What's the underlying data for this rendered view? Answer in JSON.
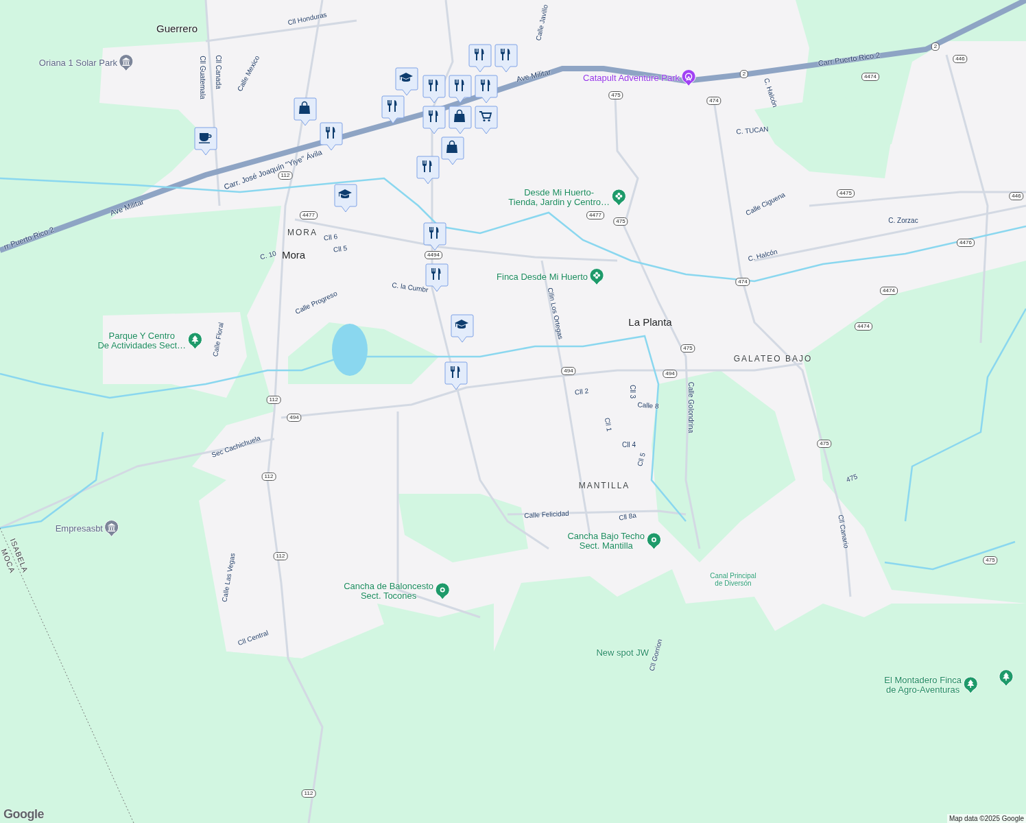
{
  "map": {
    "labels": [
      {
        "text": "Guerrero",
        "kind": "town"
      },
      {
        "text": "MORA",
        "kind": "district"
      },
      {
        "text": "Mora",
        "kind": "town"
      },
      {
        "text": "La Planta",
        "kind": "town"
      },
      {
        "text": "GALATEO BAJO",
        "kind": "district"
      },
      {
        "text": "MANTILLA",
        "kind": "district"
      },
      {
        "text": "ISABELA",
        "kind": "boundary"
      },
      {
        "text": "MOCA",
        "kind": "boundary"
      },
      {
        "text": "Cll Honduras",
        "kind": "street"
      },
      {
        "text": "Cll Guatemala",
        "kind": "street"
      },
      {
        "text": "Cll Canada",
        "kind": "street"
      },
      {
        "text": "Calle Mexico",
        "kind": "street"
      },
      {
        "text": "Carr. José Joaquín \"Yiye\" Ávila",
        "kind": "highway"
      },
      {
        "text": "Ave Militar",
        "kind": "highway"
      },
      {
        "text": "rr Puerto Rico 2",
        "kind": "highway"
      },
      {
        "text": "Ave Militar",
        "kind": "highway"
      },
      {
        "text": "Carr Puerto Rico 2",
        "kind": "highway"
      },
      {
        "text": "Calle Javillo",
        "kind": "street"
      },
      {
        "text": "C. Halcón",
        "kind": "street"
      },
      {
        "text": "C. TUCAN",
        "kind": "street"
      },
      {
        "text": "Calle Ciguena",
        "kind": "street"
      },
      {
        "text": "C. Zorzac",
        "kind": "street"
      },
      {
        "text": "C. Halcón",
        "kind": "street"
      },
      {
        "text": "Cll 6",
        "kind": "street"
      },
      {
        "text": "Cll 5",
        "kind": "street"
      },
      {
        "text": "C. 10",
        "kind": "street"
      },
      {
        "text": "C. la Cumbr",
        "kind": "street"
      },
      {
        "text": "Calle Progreso",
        "kind": "street"
      },
      {
        "text": "Cllin Los Ortegas",
        "kind": "street"
      },
      {
        "text": "Calle Floral",
        "kind": "street"
      },
      {
        "text": "Cll 2",
        "kind": "street"
      },
      {
        "text": "Cll 3",
        "kind": "street"
      },
      {
        "text": "Calle 8",
        "kind": "street"
      },
      {
        "text": "Cll 1",
        "kind": "street"
      },
      {
        "text": "Cll 4",
        "kind": "street"
      },
      {
        "text": "Cll 5",
        "kind": "street"
      },
      {
        "text": "Calle Golondrina",
        "kind": "street"
      },
      {
        "text": "475",
        "kind": "street"
      },
      {
        "text": "Cll Canario",
        "kind": "street"
      },
      {
        "text": "Calle Felicidad",
        "kind": "street"
      },
      {
        "text": "Cll 8a",
        "kind": "street"
      },
      {
        "text": "Sec Cachichuela",
        "kind": "street"
      },
      {
        "text": "Calle Las Vegas",
        "kind": "street"
      },
      {
        "text": "Cll Central",
        "kind": "street"
      },
      {
        "text": "Cll Gorrion",
        "kind": "street"
      },
      {
        "text": "Canal Principal\nde Diversón",
        "kind": "water"
      }
    ],
    "places": [
      {
        "text": "Oriana 1 Solar Park",
        "kind": "landmark"
      },
      {
        "text": "Catapult Adventure Park",
        "kind": "attraction"
      },
      {
        "text": "Desde Mi Huerto-\nTienda, Jardin y Centro…",
        "kind": "garden"
      },
      {
        "text": "Finca Desde Mi Huerto",
        "kind": "garden"
      },
      {
        "text": "Parque Y Centro\nDe Actividades Sect…",
        "kind": "park"
      },
      {
        "text": "Empresasbt",
        "kind": "landmark"
      },
      {
        "text": "Cancha Bajo Techo\nSect. Mantilla",
        "kind": "sports"
      },
      {
        "text": "Cancha de Baloncesto\nSect. Tocones",
        "kind": "sports"
      },
      {
        "text": "New spot JW",
        "kind": "none"
      },
      {
        "text": "El Montadero Finca\nde Agro-Aventuras",
        "kind": "park"
      },
      {
        "kind": "park"
      }
    ],
    "routes": [
      {
        "text": "112"
      },
      {
        "text": "4477"
      },
      {
        "text": "4494"
      },
      {
        "text": "475"
      },
      {
        "text": "474"
      },
      {
        "text": "2"
      },
      {
        "text": "2"
      },
      {
        "text": "446"
      },
      {
        "text": "4474"
      },
      {
        "text": "4477"
      },
      {
        "text": "475"
      },
      {
        "text": "4475"
      },
      {
        "text": "446"
      },
      {
        "text": "4476"
      },
      {
        "text": "474"
      },
      {
        "text": "4474"
      },
      {
        "text": "475"
      },
      {
        "text": "494"
      },
      {
        "text": "494"
      },
      {
        "text": "4474"
      },
      {
        "text": "112"
      },
      {
        "text": "494"
      },
      {
        "text": "112"
      },
      {
        "text": "112"
      },
      {
        "text": "475"
      },
      {
        "text": "475"
      },
      {
        "text": "112"
      }
    ],
    "markers": [
      {
        "kind": "cafe"
      },
      {
        "kind": "shopping"
      },
      {
        "kind": "restaurant"
      },
      {
        "kind": "school"
      },
      {
        "kind": "restaurant"
      },
      {
        "kind": "restaurant"
      },
      {
        "kind": "restaurant"
      },
      {
        "kind": "restaurant"
      },
      {
        "kind": "restaurant"
      },
      {
        "kind": "restaurant"
      },
      {
        "kind": "shopping"
      },
      {
        "kind": "restaurant"
      },
      {
        "kind": "grocery"
      },
      {
        "kind": "shopping"
      },
      {
        "kind": "restaurant"
      },
      {
        "kind": "school"
      },
      {
        "kind": "restaurant"
      },
      {
        "kind": "restaurant"
      },
      {
        "kind": "school"
      },
      {
        "kind": "restaurant"
      }
    ]
  },
  "footer": {
    "logo": "Google",
    "attribution": "Map data ©2025 Google"
  }
}
